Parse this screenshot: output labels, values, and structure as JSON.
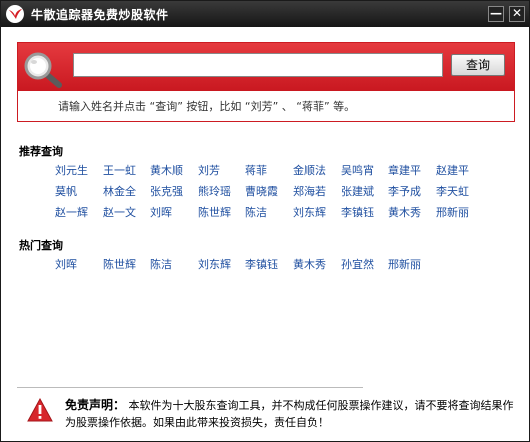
{
  "window": {
    "title": "牛散追踪器免费炒股软件",
    "minimize_glyph": "—",
    "close_glyph": "✕"
  },
  "search": {
    "input_value": "",
    "button_label": "查询",
    "hint": "请输入姓名并点击 “查询” 按钮，比如 “刘芳” 、 “蒋菲” 等。"
  },
  "recommended": {
    "title": "推荐查询",
    "names": [
      "刘元生",
      "王一虹",
      "黄木顺",
      "刘芳",
      "蒋菲",
      "金顺法",
      "吴鸣宵",
      "章建平",
      "赵建平",
      "莫帆",
      "林金全",
      "张克强",
      "熊玲瑶",
      "曹晓霞",
      "郑海若",
      "张建斌",
      "李予成",
      "李天虹",
      "赵一辉",
      "赵一文",
      "刘晖",
      "陈世辉",
      "陈洁",
      "刘东辉",
      "李镇钰",
      "黄木秀",
      "邢新丽"
    ]
  },
  "hot": {
    "title": "热门查询",
    "names": [
      "刘晖",
      "陈世辉",
      "陈洁",
      "刘东辉",
      "李镇钰",
      "黄木秀",
      "孙宜然",
      "邢新丽"
    ]
  },
  "disclaimer": {
    "label": "免责声明：",
    "text_line1": "本软件为十大股东查询工具，并不构成任何股票操作建议，请不要将查询结果作",
    "text_line2": "为股票操作依据。如果由此带来投资损失，责任自负！"
  },
  "icons": {
    "app": "red-bird-logo-icon",
    "search": "magnifier-icon",
    "warning": "warning-triangle-icon"
  },
  "colors": {
    "accent_red": "#cc1b22",
    "link_blue": "#1f4fa0",
    "titlebar": "#1e1e1e"
  }
}
